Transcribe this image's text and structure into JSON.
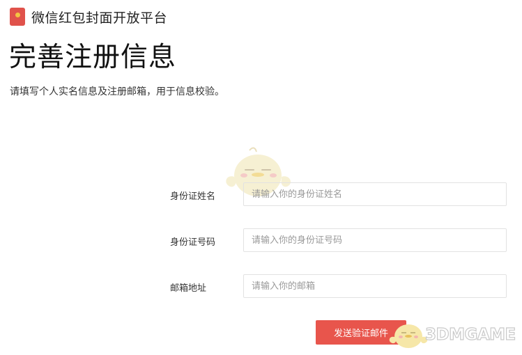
{
  "header": {
    "brand": "微信红包封面开放平台"
  },
  "main": {
    "title": "完善注册信息",
    "subtitle": "请填写个人实名信息及注册邮箱，用于信息校验。"
  },
  "form": {
    "fields": [
      {
        "label": "身份证姓名",
        "placeholder": "请输入你的身份证姓名",
        "value": ""
      },
      {
        "label": "身份证号码",
        "placeholder": "请输入你的身份证号码",
        "value": ""
      },
      {
        "label": "邮箱地址",
        "placeholder": "请输入你的邮箱",
        "value": ""
      }
    ],
    "submit_label": "发送验证邮件"
  },
  "watermark": {
    "text": "3DMGAME"
  },
  "colors": {
    "accent": "#e8554c",
    "logo": "#e0524b",
    "input_border": "#e2e2e2"
  },
  "icons": {
    "logo": "red-envelope-icon",
    "mascot": "mascot-icon",
    "watermark_mascot": "watermark-mascot-icon"
  }
}
